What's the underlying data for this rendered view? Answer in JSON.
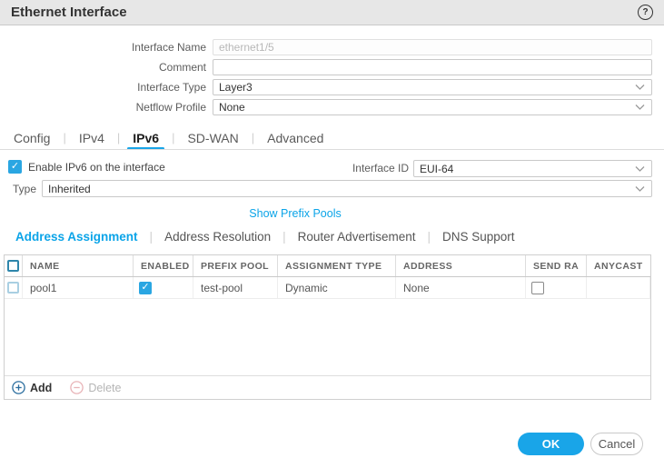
{
  "window": {
    "title": "Ethernet Interface"
  },
  "form": {
    "fields": [
      {
        "label": "Interface Name",
        "value": "ethernet1/5",
        "type": "text-disabled"
      },
      {
        "label": "Comment",
        "value": "",
        "type": "text"
      },
      {
        "label": "Interface Type",
        "value": "Layer3",
        "type": "select"
      },
      {
        "label": "Netflow Profile",
        "value": "None",
        "type": "select"
      }
    ]
  },
  "tabs": {
    "items": [
      "Config",
      "IPv4",
      "IPv6",
      "SD-WAN",
      "Advanced"
    ],
    "active": "IPv6"
  },
  "ipv6": {
    "enable_label": "Enable IPv6 on the interface",
    "enable_checked": true,
    "interface_id_label": "Interface ID",
    "interface_id_value": "EUI-64",
    "type_label": "Type",
    "type_value": "Inherited",
    "show_prefix_pools_link": "Show Prefix Pools"
  },
  "subtabs": {
    "items": [
      "Address Assignment",
      "Address Resolution",
      "Router Advertisement",
      "DNS Support"
    ],
    "active": "Address Assignment"
  },
  "table": {
    "columns": [
      "NAME",
      "ENABLED",
      "PREFIX POOL",
      "ASSIGNMENT TYPE",
      "ADDRESS",
      "SEND RA",
      "ANYCAST"
    ],
    "rows": [
      {
        "selected": false,
        "name": "pool1",
        "enabled": true,
        "prefix_pool": "test-pool",
        "assignment_type": "Dynamic",
        "address": "None",
        "send_ra": false,
        "anycast": ""
      }
    ],
    "add_label": "Add",
    "delete_label": "Delete",
    "delete_disabled": true
  },
  "buttons": {
    "ok": "OK",
    "cancel": "Cancel"
  },
  "colors": {
    "accent": "#19a5e8",
    "link": "#0ba4e8",
    "check": "#2aa6e2"
  }
}
